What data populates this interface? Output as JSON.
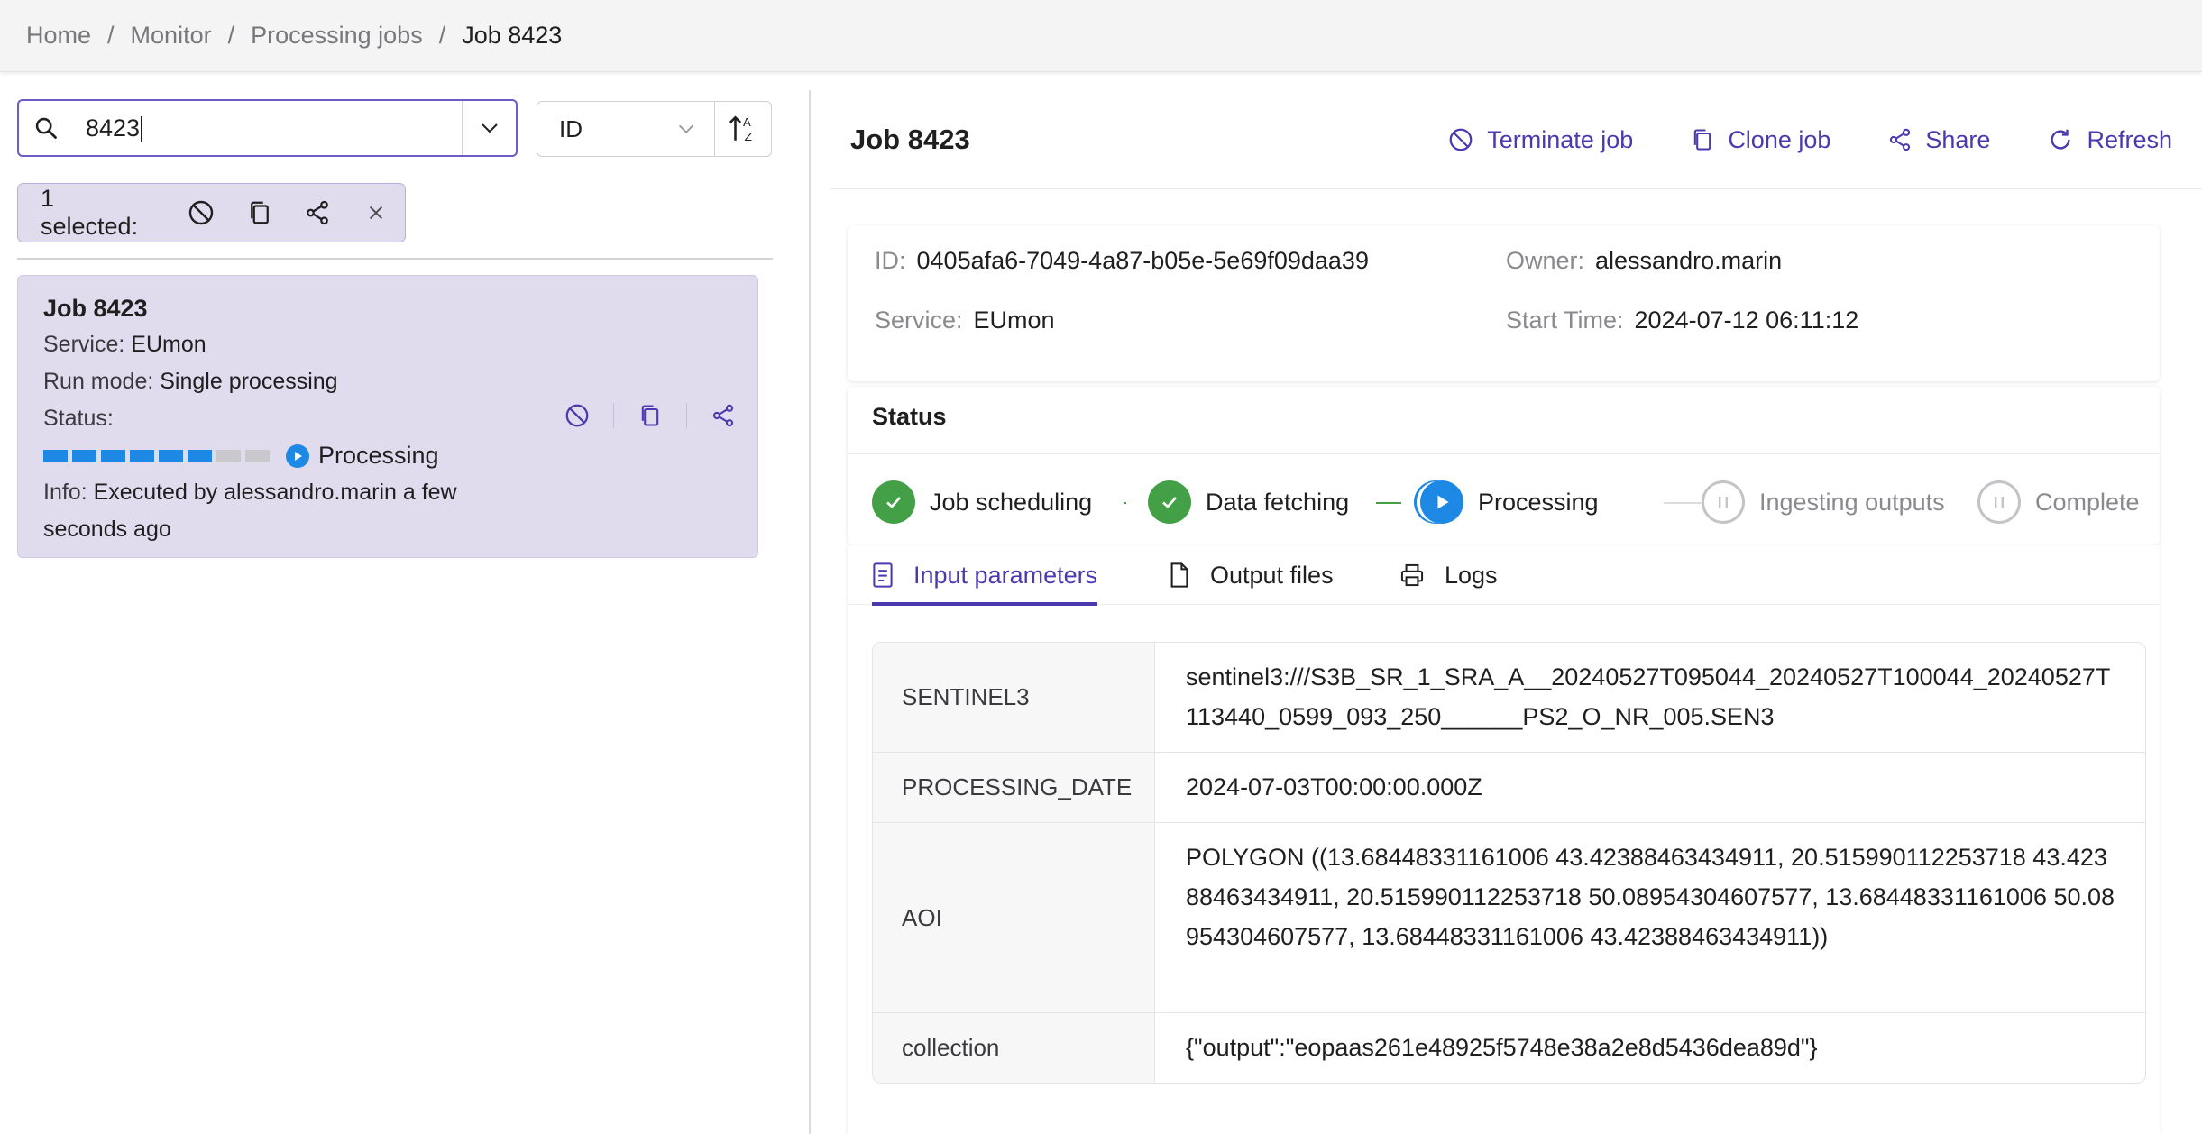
{
  "breadcrumb": {
    "items": [
      "Home",
      "Monitor",
      "Processing jobs"
    ],
    "separator": "/",
    "current": "Job 8423"
  },
  "search": {
    "value": "8423"
  },
  "sort": {
    "field": "ID"
  },
  "selection": {
    "label": "1 selected:"
  },
  "job_card": {
    "title": "Job 8423",
    "service_key": "Service:",
    "service_val": "EUmon",
    "runmode_key": "Run mode:",
    "runmode_val": "Single processing",
    "status_key": "Status:",
    "progress": {
      "segments_total": 8,
      "segments_done": 6
    },
    "status_val": "Processing",
    "info_key": "Info:",
    "info_val": "Executed by alessandro.marin a few seconds ago"
  },
  "header": {
    "title": "Job 8423",
    "terminate": "Terminate job",
    "clone": "Clone job",
    "share": "Share",
    "refresh": "Refresh"
  },
  "details": {
    "id_key": "ID:",
    "id_val": "0405afa6-7049-4a87-b05e-5e69f09daa39",
    "owner_key": "Owner:",
    "owner_val": "alessandro.marin",
    "service_key": "Service:",
    "service_val": "EUmon",
    "start_key": "Start Time:",
    "start_val": "2024-07-12 06:11:12"
  },
  "status": {
    "title": "Status",
    "steps": [
      {
        "label": "Job scheduling",
        "state": "done"
      },
      {
        "label": "Data fetching",
        "state": "done"
      },
      {
        "label": "Processing",
        "state": "active"
      },
      {
        "label": "Ingesting outputs",
        "state": "pending"
      },
      {
        "label": "Complete",
        "state": "pending"
      }
    ]
  },
  "tabs": [
    {
      "label": "Input parameters",
      "icon": "list-icon",
      "active": true
    },
    {
      "label": "Output files",
      "icon": "file-icon",
      "active": false
    },
    {
      "label": "Logs",
      "icon": "printer-icon",
      "active": false
    }
  ],
  "params": [
    {
      "key": "SENTINEL3",
      "value": "sentinel3:///S3B_SR_1_SRA_A__20240527T095044_20240527T100044_20240527T113440_0599_093_250______PS2_O_NR_005.SEN3"
    },
    {
      "key": "PROCESSING_DATE",
      "value": "2024-07-03T00:00:00.000Z"
    },
    {
      "key": "AOI",
      "value": "POLYGON ((13.68448331161006 43.42388463434911, 20.515990112253718 43.42388463434911, 20.515990112253718 50.08954304607577, 13.68448331161006 50.08954304607577, 13.68448331161006 43.42388463434911))"
    },
    {
      "key": "collection",
      "value": "{\"output\":\"eopaas261e48925f5748e38a2e8d5436dea89d\"}"
    }
  ],
  "colors": {
    "accent": "#4b39b0",
    "selected_bg": "#e0dcee",
    "progress_blue": "#1e88e5",
    "done_green": "#43a047"
  }
}
